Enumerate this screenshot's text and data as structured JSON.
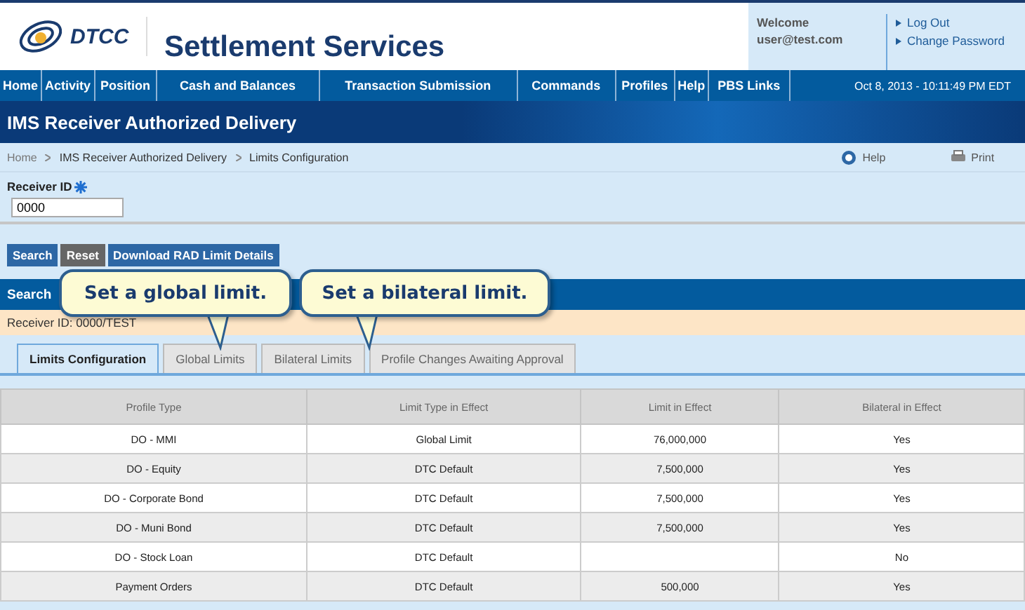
{
  "header": {
    "brand": "DTCC",
    "title": "Settlement Services",
    "welcome": "Welcome",
    "user": "user@test.com",
    "links": [
      "Log Out",
      "Change Password"
    ]
  },
  "nav": {
    "items": [
      "Home",
      "Activity",
      "Position",
      "Cash and Balances",
      "Transaction Submission",
      "Commands",
      "Profiles",
      "Help",
      "PBS Links"
    ],
    "datetime": "Oct 8, 2013 - 10:11:49 PM EDT"
  },
  "banner": {
    "title": "IMS Receiver Authorized Delivery"
  },
  "breadcrumb": [
    "Home",
    "IMS Receiver Authorized Delivery",
    "Limits Configuration"
  ],
  "tools": [
    "Help",
    "Print"
  ],
  "receiver_field": {
    "label": "Receiver ID",
    "value": "0000"
  },
  "buttons": [
    {
      "label": "Search",
      "kind": "primary"
    },
    {
      "label": "Reset",
      "kind": "secondary"
    },
    {
      "label": "Download RAD Limit Details",
      "kind": "primary"
    }
  ],
  "results_bar": {
    "title": "Search"
  },
  "receiver_line": "Receiver ID: 0000/TEST",
  "callouts": [
    "Set a global limit.",
    "Set a bilateral limit."
  ],
  "tabs": [
    {
      "label": "Limits Configuration",
      "selected": true
    },
    {
      "label": "Global Limits",
      "selected": false
    },
    {
      "label": "Bilateral Limits",
      "selected": false
    },
    {
      "label": "Profile Changes Awaiting Approval",
      "selected": false
    }
  ],
  "table": {
    "columns": [
      "Profile Type",
      "Limit Type in Effect",
      "Limit in Effect",
      "Bilateral in Effect"
    ],
    "rows": [
      [
        "DO - MMI",
        "Global Limit",
        "76,000,000",
        "Yes"
      ],
      [
        "DO - Equity",
        "DTC Default",
        "7,500,000",
        "Yes"
      ],
      [
        "DO - Corporate Bond",
        "DTC Default",
        "7,500,000",
        "Yes"
      ],
      [
        "DO - Muni Bond",
        "DTC Default",
        "7,500,000",
        "Yes"
      ],
      [
        "DO - Stock Loan",
        "DTC Default",
        "",
        "No"
      ],
      [
        "Payment Orders",
        "DTC Default",
        "500,000",
        "Yes"
      ]
    ]
  }
}
